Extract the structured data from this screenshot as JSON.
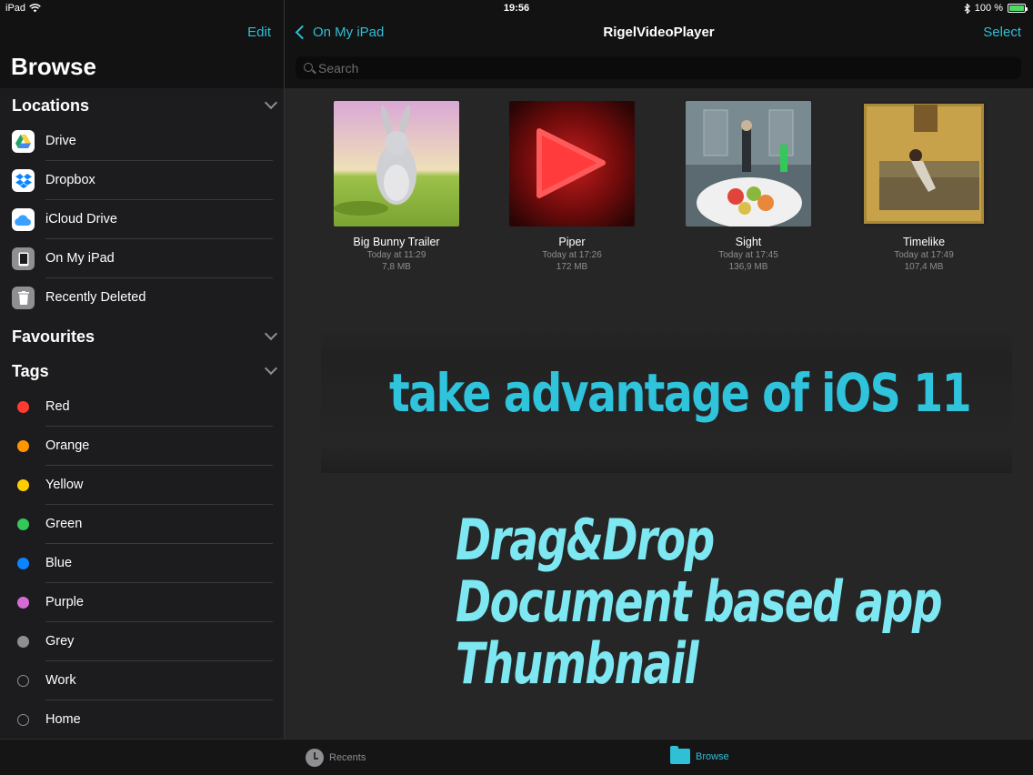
{
  "status_bar": {
    "device": "iPad",
    "time": "19:56",
    "battery": "100 %",
    "battery_level": 1.0
  },
  "sidebar": {
    "edit_label": "Edit",
    "title": "Browse",
    "locations_header": "Locations",
    "locations": [
      {
        "label": "Drive",
        "icon": "google-drive-icon"
      },
      {
        "label": "Dropbox",
        "icon": "dropbox-icon"
      },
      {
        "label": "iCloud Drive",
        "icon": "icloud-icon"
      },
      {
        "label": "On My iPad",
        "icon": "ipad-icon"
      },
      {
        "label": "Recently Deleted",
        "icon": "trash-icon"
      }
    ],
    "favourites_header": "Favourites",
    "tags_header": "Tags",
    "tags": [
      {
        "label": "Red",
        "color": "#ff3b30"
      },
      {
        "label": "Orange",
        "color": "#ff9500"
      },
      {
        "label": "Yellow",
        "color": "#ffcc00"
      },
      {
        "label": "Green",
        "color": "#34c759"
      },
      {
        "label": "Blue",
        "color": "#0a84ff"
      },
      {
        "label": "Purple",
        "color": "#d66bd6"
      },
      {
        "label": "Grey",
        "color": "#8e8e93"
      },
      {
        "label": "Work",
        "color": ""
      },
      {
        "label": "Home",
        "color": ""
      }
    ]
  },
  "header": {
    "back_label": "On My iPad",
    "title": "RigelVideoPlayer",
    "select_label": "Select",
    "search_placeholder": "Search"
  },
  "files": [
    {
      "name": "Big Bunny Trailer",
      "date": "Today at 11:29",
      "size": "7,8 MB"
    },
    {
      "name": "Piper",
      "date": "Today at 17:26",
      "size": "172 MB"
    },
    {
      "name": "Sight",
      "date": "Today at 17:45",
      "size": "136,9 MB"
    },
    {
      "name": "Timelike",
      "date": "Today at 17:49",
      "size": "107,4 MB"
    }
  ],
  "promo": {
    "headline": "take advantage of iOS 11",
    "features": [
      "Drag&Drop",
      "Document based app",
      "Thumbnail"
    ]
  },
  "tabbar": {
    "recents_label": "Recents",
    "browse_label": "Browse",
    "accent": "#2fbfd6"
  }
}
